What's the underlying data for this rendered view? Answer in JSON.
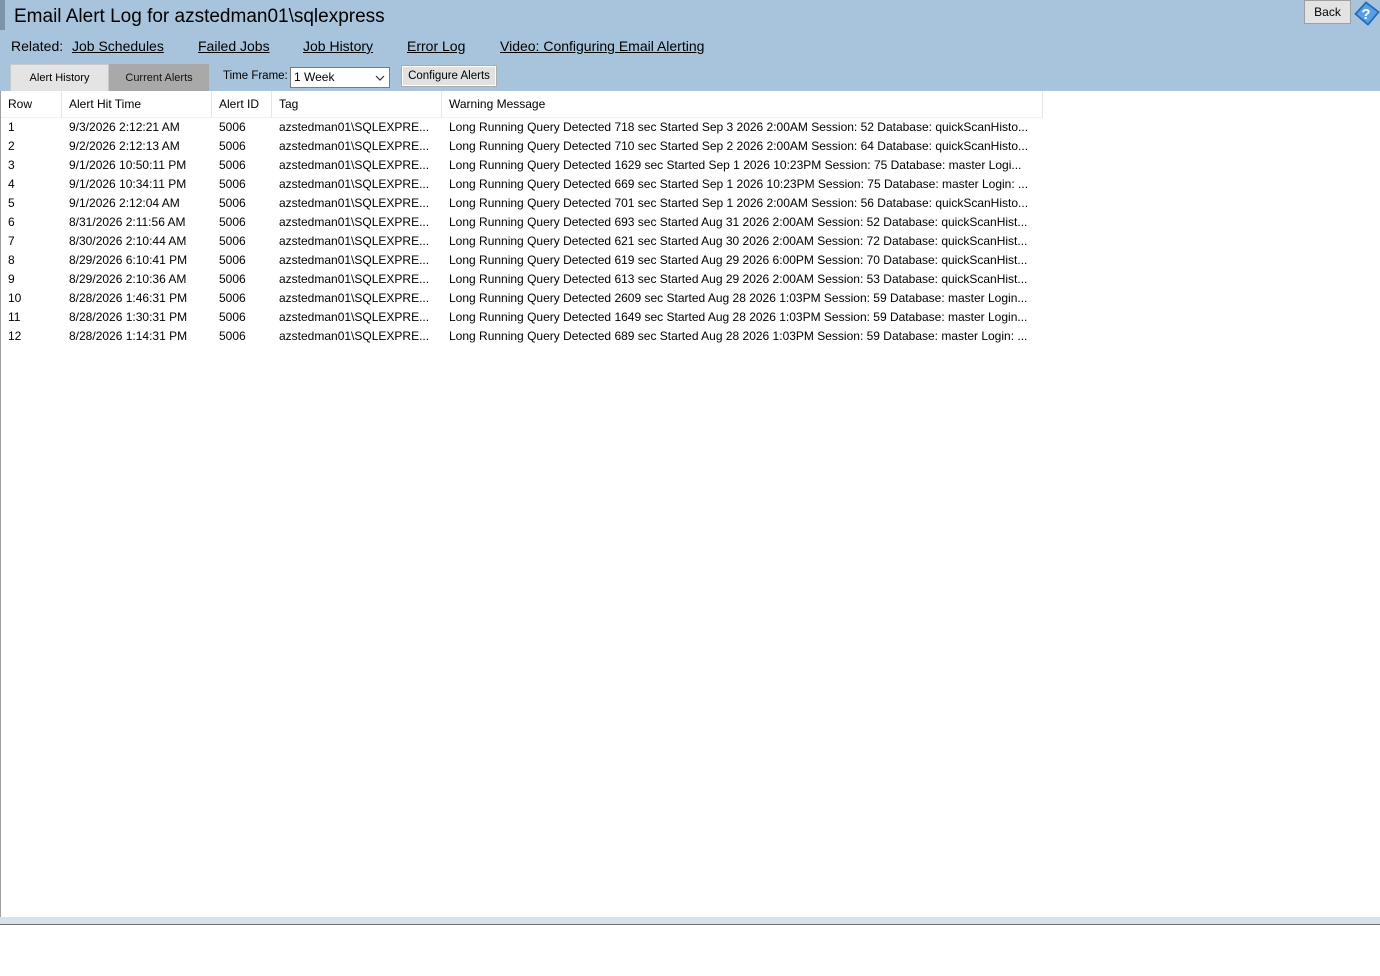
{
  "title": "Email Alert Log for azstedman01\\sqlexpress",
  "related": {
    "label": "Related:",
    "links": [
      "Job Schedules",
      "Failed Jobs",
      "Job History",
      "Error Log",
      "Video: Configuring Email Alerting"
    ]
  },
  "back_label": "Back",
  "tabs": [
    "Alert History",
    "Current Alerts"
  ],
  "active_tab": "Current Alerts",
  "time_frame": {
    "label": "Time Frame:",
    "value": "1 Week"
  },
  "configure_label": "Configure Alerts",
  "table": {
    "columns": [
      "Row",
      "Alert Hit Time",
      "Alert ID",
      "Tag",
      "Warning Message"
    ],
    "rows": [
      [
        "1",
        "9/3/2026 2:12:21 AM",
        "5006",
        "azstedman01\\SQLEXPRE...",
        "Long Running Query Detected 718 sec Started Sep 3 2026 2:00AM Session: 52 Database: quickScanHisto..."
      ],
      [
        "2",
        "9/2/2026 2:12:13 AM",
        "5006",
        "azstedman01\\SQLEXPRE...",
        "Long Running Query Detected 710 sec Started Sep 2 2026 2:00AM Session: 64 Database: quickScanHisto..."
      ],
      [
        "3",
        "9/1/2026 10:50:11 PM",
        "5006",
        "azstedman01\\SQLEXPRE...",
        "Long Running Query Detected 1629 sec Started Sep 1 2026 10:23PM Session: 75 Database: master Logi..."
      ],
      [
        "4",
        "9/1/2026 10:34:11 PM",
        "5006",
        "azstedman01\\SQLEXPRE...",
        "Long Running Query Detected 669 sec Started Sep 1 2026 10:23PM Session: 75 Database: master Login: ..."
      ],
      [
        "5",
        "9/1/2026 2:12:04 AM",
        "5006",
        "azstedman01\\SQLEXPRE...",
        "Long Running Query Detected 701 sec Started Sep 1 2026 2:00AM Session: 56 Database: quickScanHisto..."
      ],
      [
        "6",
        "8/31/2026 2:11:56 AM",
        "5006",
        "azstedman01\\SQLEXPRE...",
        "Long Running Query Detected 693 sec Started Aug 31 2026 2:00AM Session: 52 Database: quickScanHist..."
      ],
      [
        "7",
        "8/30/2026 2:10:44 AM",
        "5006",
        "azstedman01\\SQLEXPRE...",
        "Long Running Query Detected 621 sec Started Aug 30 2026 2:00AM Session: 72 Database: quickScanHist..."
      ],
      [
        "8",
        "8/29/2026 6:10:41 PM",
        "5006",
        "azstedman01\\SQLEXPRE...",
        "Long Running Query Detected 619 sec Started Aug 29 2026 6:00PM Session: 70 Database: quickScanHist..."
      ],
      [
        "9",
        "8/29/2026 2:10:36 AM",
        "5006",
        "azstedman01\\SQLEXPRE...",
        "Long Running Query Detected 613 sec Started Aug 29 2026 2:00AM Session: 53 Database: quickScanHist..."
      ],
      [
        "10",
        "8/28/2026 1:46:31 PM",
        "5006",
        "azstedman01\\SQLEXPRE...",
        "Long Running Query Detected 2609 sec Started Aug 28 2026 1:03PM Session: 59 Database: master Login..."
      ],
      [
        "11",
        "8/28/2026 1:30:31 PM",
        "5006",
        "azstedman01\\SQLEXPRE...",
        "Long Running Query Detected 1649 sec Started Aug 28 2026 1:03PM Session: 59 Database: master Login..."
      ],
      [
        "12",
        "8/28/2026 1:14:31 PM",
        "5006",
        "azstedman01\\SQLEXPRE...",
        "Long Running Query Detected 689 sec Started Aug 28 2026 1:03PM Session: 59 Database: master Login: ..."
      ]
    ]
  },
  "colors": {
    "header_bg": "#a8c4dc",
    "active_tab": "#a9a9a9",
    "help_icon": "#2f7fd3"
  },
  "icons": {
    "help": "help-question-icon",
    "dropdown": "chevron-down-icon"
  }
}
